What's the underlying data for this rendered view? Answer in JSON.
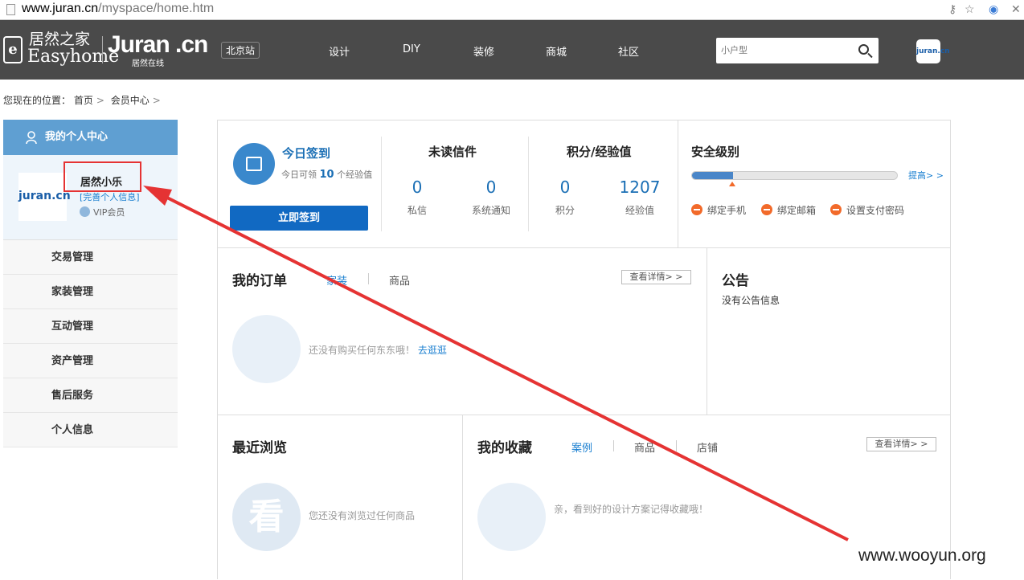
{
  "browser": {
    "url_domain": "www.juran.cn",
    "url_path": "/myspace/home.htm"
  },
  "header": {
    "logo_cn": "居然之家",
    "logo_en": "Easyhome",
    "logo_juran": "Juran .cn",
    "logo_sub": "居然在线",
    "city": "北京站",
    "menu": [
      "设计",
      "DIY",
      "装修",
      "商城",
      "社区"
    ],
    "search_placeholder": "小户型",
    "avatar_text": "juran.cn"
  },
  "breadcrumb": {
    "prefix": "您现在的位置：",
    "items": [
      "首页",
      "会员中心"
    ]
  },
  "sidebar": {
    "title": "我的个人中心",
    "logo_text": "juran.cn",
    "username": "居然小乐",
    "complete_link": "[完善个人信息]",
    "vip": "VIP会员",
    "items": [
      "交易管理",
      "家装管理",
      "互动管理",
      "资产管理",
      "售后服务",
      "个人信息"
    ]
  },
  "signin": {
    "title": "今日签到",
    "desc_pre": "今日可领",
    "points": "10",
    "desc_post": "个经验值",
    "button": "立即签到"
  },
  "messages": {
    "title": "未读信件",
    "private_count": "0",
    "private_label": "私信",
    "system_count": "0",
    "system_label": "系统通知"
  },
  "score": {
    "title": "积分/经验值",
    "points": "0",
    "points_label": "积分",
    "exp": "1207",
    "exp_label": "经验值"
  },
  "security": {
    "title": "安全级别",
    "level": 0.2,
    "improve": "提高> >",
    "items": [
      "绑定手机",
      "绑定邮箱",
      "设置支付密码"
    ]
  },
  "orders": {
    "title": "我的订单",
    "tabs": [
      "家装",
      "商品"
    ],
    "detail": "查看详情> >",
    "empty": "还没有购买任何东东哦！",
    "link": "去逛逛"
  },
  "notice": {
    "title": "公告",
    "empty": "没有公告信息"
  },
  "recent": {
    "title": "最近浏览",
    "icon_text": "看",
    "empty": "您还没有浏览过任何商品"
  },
  "favorites": {
    "title": "我的收藏",
    "tabs": [
      "案例",
      "商品",
      "店铺"
    ],
    "detail": "查看详情> >",
    "empty": "亲，看到好的设计方案记得收藏哦！"
  },
  "watermark": "www.wooyun.org",
  "colors": {
    "nav_bg": "#4a4a4a",
    "accent": "#1169c2",
    "sidebar_head": "#5f9fd2",
    "annotation": "#e53333",
    "warn": "#f26a2a"
  }
}
